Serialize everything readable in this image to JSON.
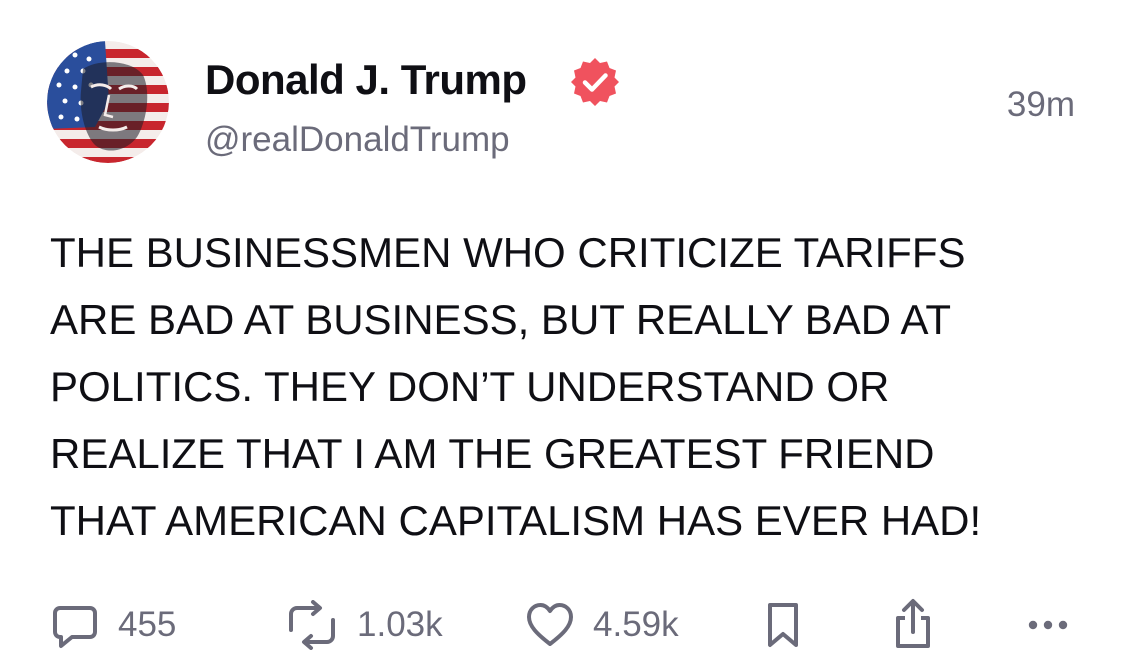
{
  "author": {
    "display_name": "Donald J. Trump",
    "handle": "@realDonaldTrump",
    "verified": true,
    "verified_color": "#f0525e"
  },
  "post": {
    "timestamp": "39m",
    "lines": [
      "THE BUSINESSMEN WHO CRITICIZE TARIFFS",
      "ARE BAD AT BUSINESS, BUT REALLY BAD AT",
      "POLITICS. THEY DON’T UNDERSTAND OR",
      "REALIZE THAT I AM THE GREATEST FRIEND",
      "THAT AMERICAN CAPITALISM HAS EVER HAD!"
    ]
  },
  "actions": {
    "reply_count": "455",
    "repost_count": "1.03k",
    "like_count": "4.59k",
    "icons": [
      "reply-icon",
      "repost-icon",
      "heart-icon",
      "bookmark-icon",
      "share-icon",
      "more-icon"
    ]
  },
  "colors": {
    "text": "#0f0f14",
    "muted": "#6b6b7a",
    "accent": "#f0525e"
  }
}
